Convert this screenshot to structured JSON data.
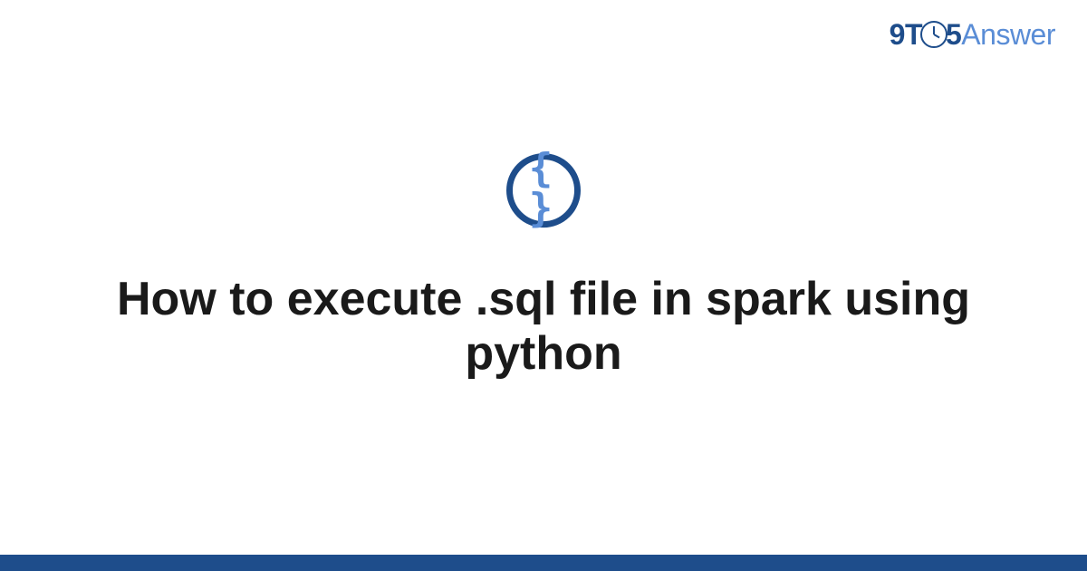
{
  "logo": {
    "prefix": "9T",
    "middle_digit": "5",
    "suffix": "Answer"
  },
  "icon": {
    "symbol": "{ }"
  },
  "title": "How to execute .sql file in spark using python",
  "colors": {
    "primary": "#1e4d8b",
    "accent": "#5a8dd6",
    "text": "#1a1a1a"
  }
}
